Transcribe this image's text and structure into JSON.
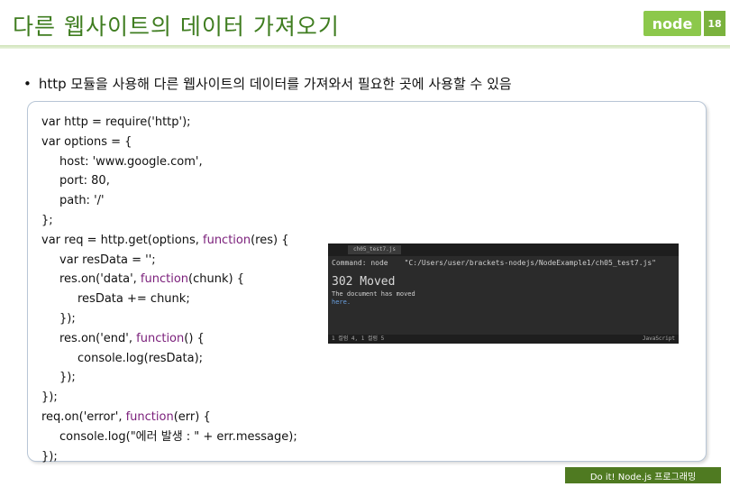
{
  "slide": {
    "title": "다른 웹사이트의 데이터 가져오기",
    "logo_text": "node",
    "page_number": "18",
    "bullet": "http 모듈을 사용해 다른 웹사이트의 데이터를 가져와서 필요한 곳에 사용할 수 있음",
    "footer": "Do it! Node.js 프로그래밍"
  },
  "code": {
    "l1": "var http = require('http');",
    "l2": "var options = {",
    "l3": "host: 'www.google.com',",
    "l4": "port: 80,",
    "l5": "path: '/'",
    "l6": "};",
    "l7a": "var req = http.get(options, ",
    "l7kw": "function",
    "l7b": "(res) {",
    "l8": "var resData = '';",
    "l9a": "res.on('data', ",
    "l9kw": "function",
    "l9b": "(chunk) {",
    "l10": "resData += chunk;",
    "l11": "});",
    "l12a": "res.on('end', ",
    "l12kw": "function",
    "l12b": "() {",
    "l13": "console.log(resData);",
    "l14": "});",
    "l15": "});",
    "l16a": "req.on('error', ",
    "l16kw": "function",
    "l16b": "(err) {",
    "l17": "console.log(\"에러 발생 : \" + err.message);",
    "l18": "});"
  },
  "console": {
    "tab_label": "ch05_test7.js",
    "command_label": "Command: node",
    "command_path": "\"C:/Users/user/brackets-nodejs/NodeExample1/ch05_test7.js\"",
    "status_big": "302 Moved",
    "message": "The document has moved",
    "link_text": "here.",
    "status_left": "1 컬럼 4, 1 컬럼 5",
    "status_right": "JavaScript"
  }
}
